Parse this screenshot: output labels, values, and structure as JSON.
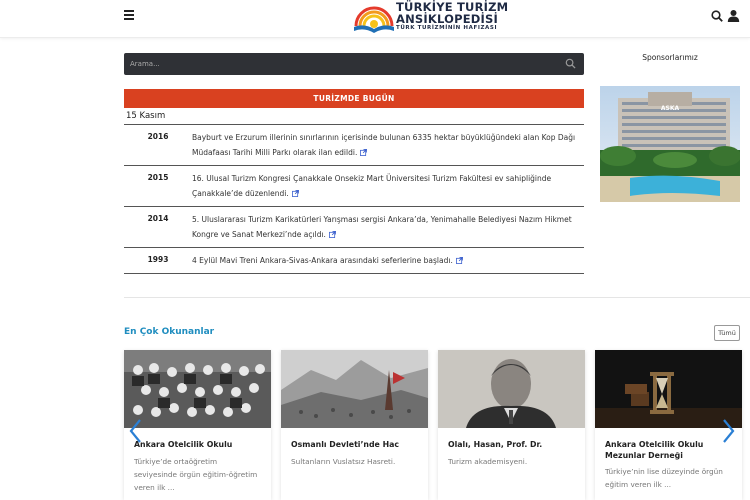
{
  "header": {
    "logo_line1": "TÜRKİYE TURİZM",
    "logo_line2": "ANSİKLOPEDİSİ",
    "logo_tagline": "TÜRK TURİZMİNİN HAFIZASI",
    "icons": [
      "menu-icon",
      "search-icon",
      "user-icon"
    ]
  },
  "search": {
    "placeholder": "Arama..."
  },
  "today": {
    "title": "TURİZMDE BUGÜN",
    "date": "15 Kasım",
    "events": [
      {
        "year": "2016",
        "text": "Bayburt ve Erzurum illerinin sınırlarının içerisinde bulunan 6335 hektar büyüklüğündeki alan Kop Dağı Müdafaası Tarihi Milli Parkı olarak ilan edildi."
      },
      {
        "year": "2015",
        "text": "16. Ulusal Turizm Kongresi Çanakkale Onsekiz Mart Üniversitesi Turizm Fakültesi ev sahipliğinde Çanakkale’de düzenlendi."
      },
      {
        "year": "2014",
        "text": "5. Uluslararası Turizm Karikatürleri Yarışması sergisi Ankara’da, Yenimahalle Belediyesi Nazım Hikmet Kongre ve Sanat Merkezi’nde açıldı."
      },
      {
        "year": "1993",
        "text": "4 Eylül Mavi Treni Ankara-Sivas-Ankara arasındaki seferlerine başladı."
      }
    ]
  },
  "sponsor": {
    "title": "Sponsorlarımız",
    "logo_text": "ASKA"
  },
  "popular": {
    "title": "En Çok Okunanlar",
    "all_label": "Tümü",
    "cards": [
      {
        "title": "Ankara Otelcilik Okulu",
        "desc": "Türkiye’de ortaöğretim seviyesinde örgün eğitim-öğretim veren ilk ..."
      },
      {
        "title": "Osmanlı Devleti’nde Hac",
        "desc": "Sultanların Vuslatsız Hasreti."
      },
      {
        "title": "Olalı, Hasan, Prof. Dr.",
        "desc": "Turizm akademisyeni."
      },
      {
        "title": "Ankara Otelcilik Okulu Mezunlar Derneği",
        "desc": "Türkiye’nin lise düzeyinde örgün eğitim veren ilk ..."
      }
    ]
  },
  "colors": {
    "accent_red": "#d94120",
    "section_blue": "#1f8dbf",
    "search_bg": "#2f3136"
  }
}
